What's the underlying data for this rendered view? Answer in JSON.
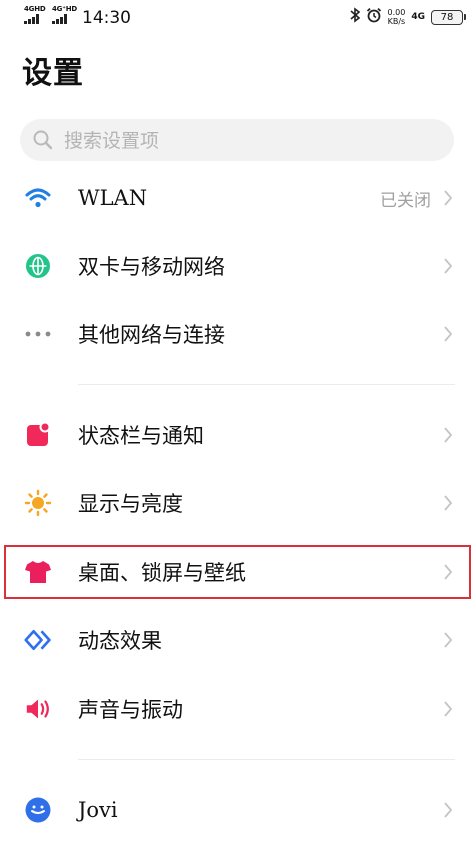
{
  "status_bar": {
    "sim1_label": "4GHD",
    "sim2_label": "4G⁺HD",
    "time": "14:30",
    "network_speed_value": "0.00",
    "network_speed_unit": "KB/s",
    "network_type": "4G",
    "battery_level": "78",
    "icons": [
      "bluetooth-icon",
      "alarm-icon"
    ]
  },
  "page": {
    "title": "设置"
  },
  "search": {
    "placeholder": "搜索设置项"
  },
  "items": [
    {
      "label": "WLAN",
      "value": "已关闭",
      "icon": "wifi-icon",
      "color": "#1f7fe6"
    },
    {
      "label": "双卡与移动网络",
      "icon": "globe-icon",
      "color": "#23c48a"
    },
    {
      "label": "其他网络与连接",
      "icon": "more-dots-icon",
      "color": "#8a8a8a"
    },
    {
      "label": "状态栏与通知",
      "icon": "notification-icon",
      "color": "#f0295a"
    },
    {
      "label": "显示与亮度",
      "icon": "sun-icon",
      "color": "#f5a623"
    },
    {
      "label": "桌面、锁屏与壁纸",
      "icon": "tshirt-icon",
      "color": "#ea1f5b"
    },
    {
      "label": "动态效果",
      "icon": "diamond-icon",
      "color": "#2d6ff0"
    },
    {
      "label": "声音与振动",
      "icon": "speaker-icon",
      "color": "#f0295a"
    },
    {
      "label": "Jovi",
      "icon": "jovi-icon",
      "color": "#2f6fe8"
    }
  ],
  "highlight_color": "#d9313a"
}
